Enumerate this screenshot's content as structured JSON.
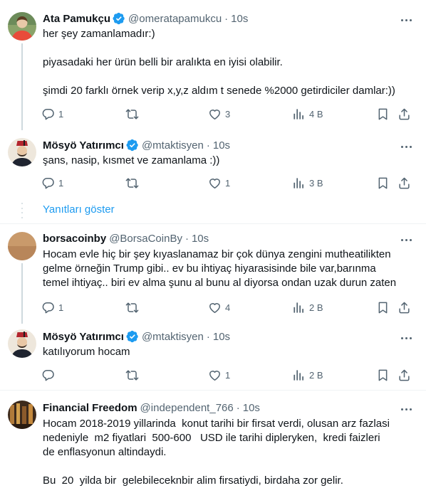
{
  "tweets": [
    {
      "name": "Ata Pamukçu",
      "handle": "@omeratapamukcu",
      "time": "10s",
      "text": "her şey zamanlamadır:)\n\npiyasadaki her ürün belli bir aralıkta en iyisi olabilir.\n\nşimdi 20 farklı örnek verip x,y,z aldım t senede %2000 getirdiciler damlar:))",
      "replies": "1",
      "retweets": "",
      "likes": "3",
      "views": "4 B"
    },
    {
      "name": "Mösyö Yatırımcı",
      "handle": "@mtaktisyen",
      "time": "10s",
      "text": "şans, nasip, kısmet ve zamanlama :))",
      "replies": "1",
      "retweets": "",
      "likes": "1",
      "views": "3 B"
    },
    {
      "name": "borsacoinby",
      "handle": "@BorsaCoinBy",
      "time": "10s",
      "text": "Hocam evle hiç bir şey kıyaslanamaz bir çok dünya zengini mutheatilikten\ngelme örneğin Trump gibi.. ev bu ihtiyaç hiyarasisinde bile var,barınma\ntemel ihtiyaç.. biri ev alma şunu al bunu al diyorsa ondan uzak durun zaten",
      "replies": "1",
      "retweets": "",
      "likes": "4",
      "views": "2 B"
    },
    {
      "name": "Mösyö Yatırımcı",
      "handle": "@mtaktisyen",
      "time": "10s",
      "text": "katılıyorum hocam",
      "replies": "",
      "retweets": "",
      "likes": "1",
      "views": "2 B"
    },
    {
      "name": "Financial Freedom",
      "handle": "@independent_766",
      "time": "10s",
      "text": "Hocam 2018-2019 yillarinda  konut tarihi bir firsat verdi, olusan arz fazlasi\nnedeniyle  m2 fiyatlari  500-600   USD ile tarihi dipleryken,  kredi faizleri\nde enflasyonun altindaydi.\n\nBu  20  yilda bir  gelebileceknbir alim firsatiydi, birdaha zor gelir."
    }
  ],
  "show_replies": "Yanıtları göster",
  "colors": {
    "text": "#0f1419",
    "secondary": "#536471",
    "accent": "#1d9bf0",
    "divider": "#eff3f4",
    "thread_line": "#cfd9de"
  },
  "icons": [
    "verified-badge-icon",
    "more-icon",
    "reply-icon",
    "retweet-icon",
    "like-icon",
    "views-icon",
    "bookmark-icon",
    "share-icon"
  ]
}
